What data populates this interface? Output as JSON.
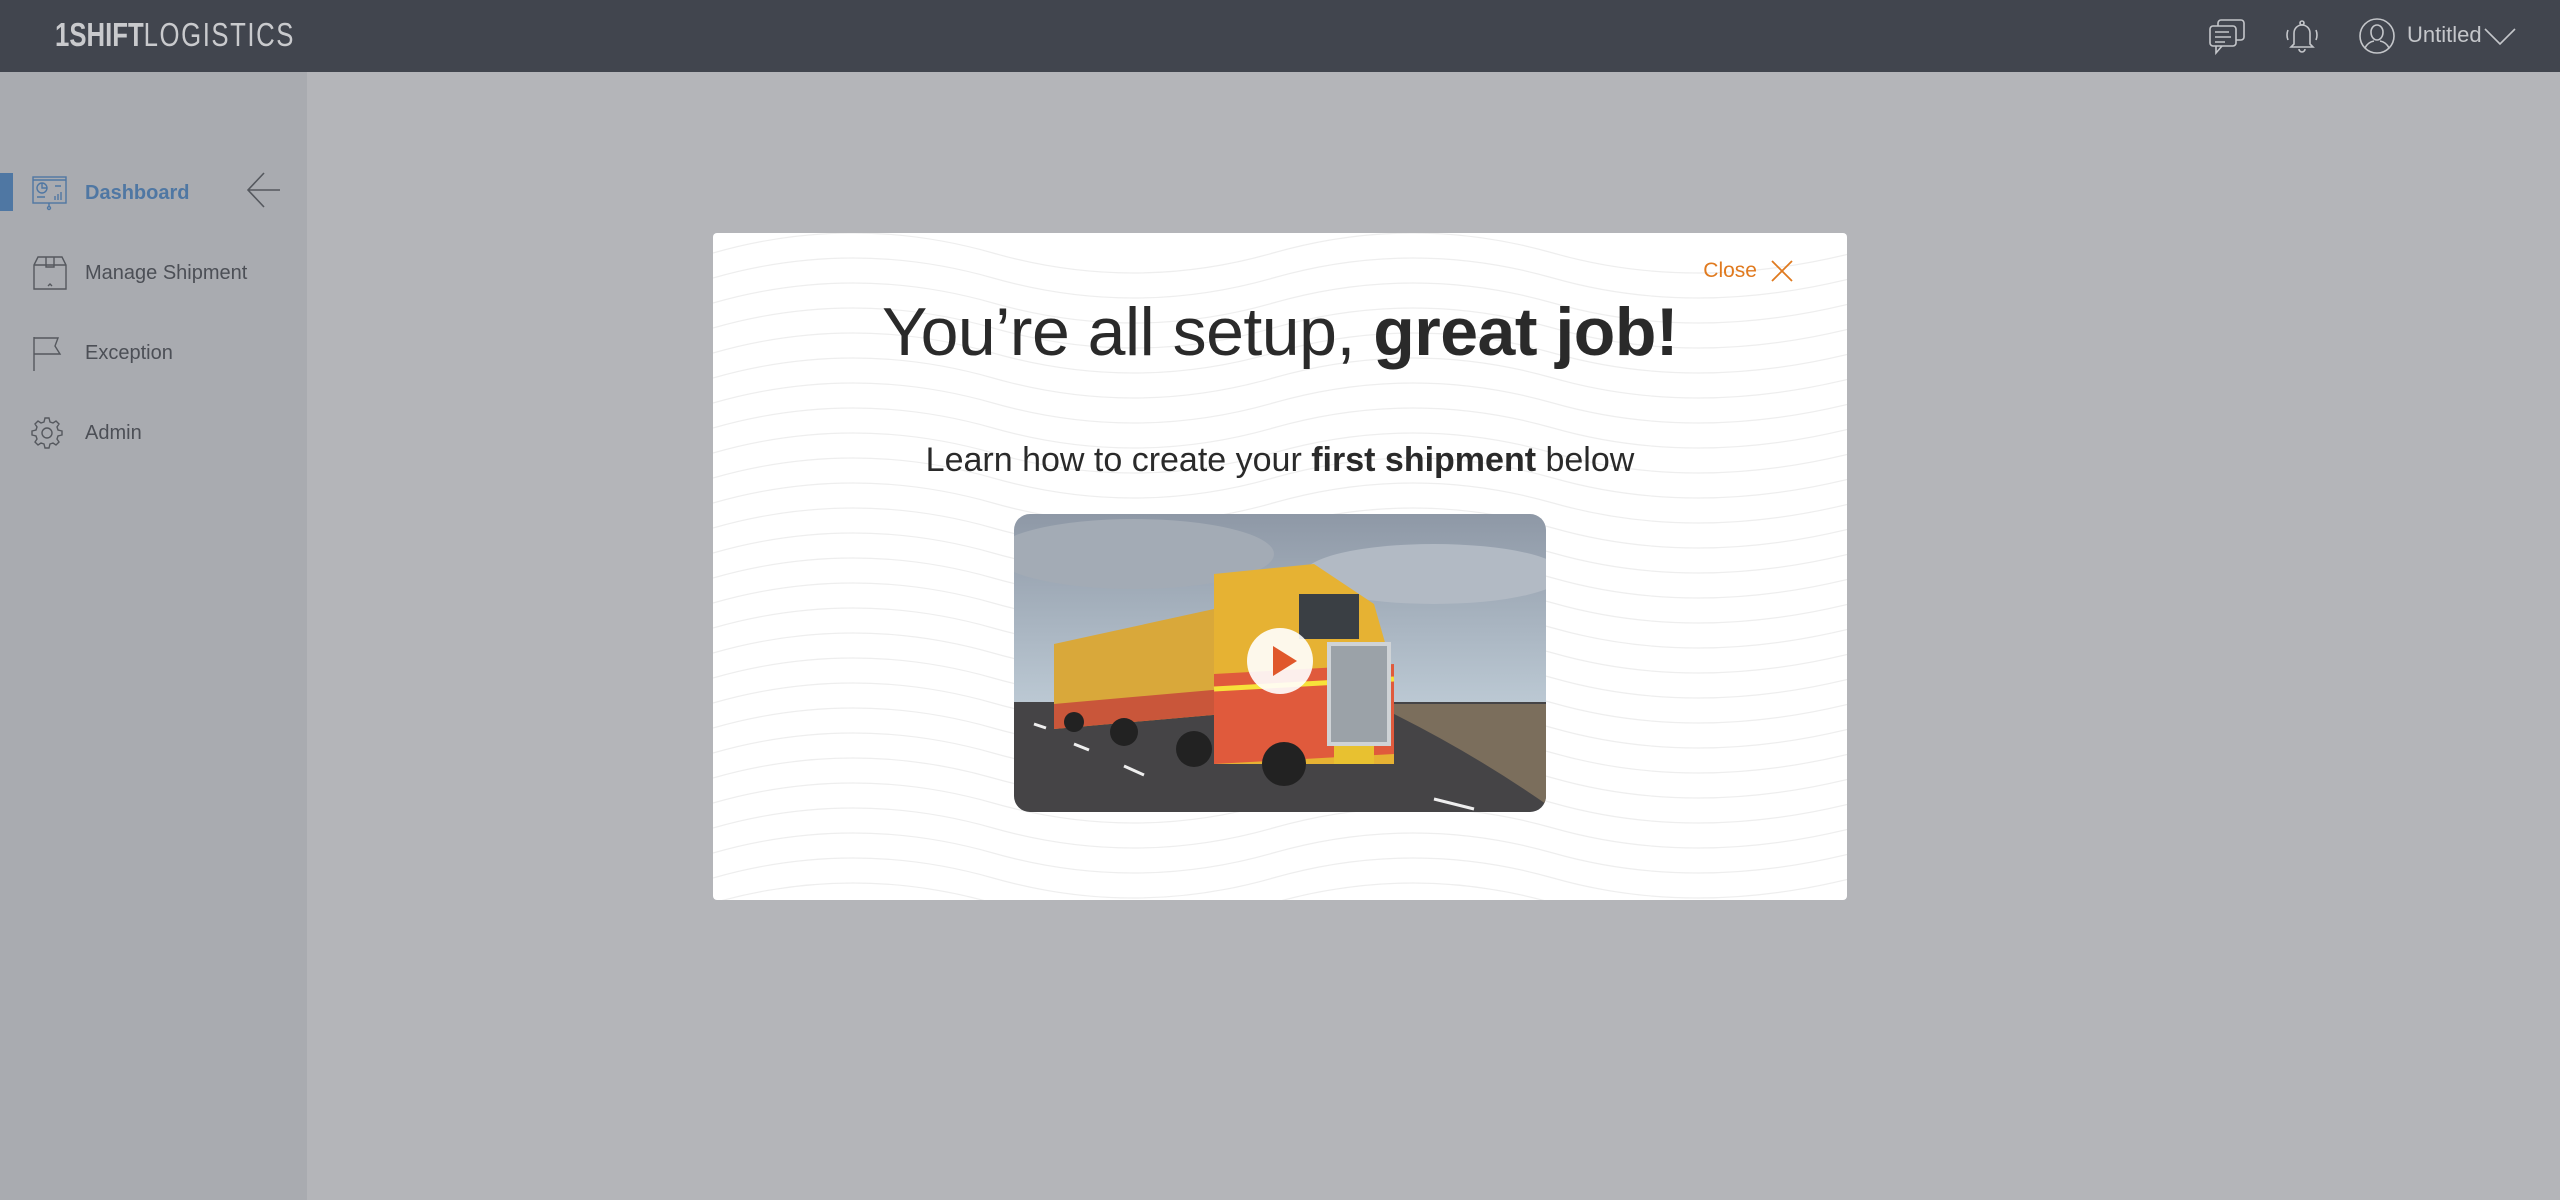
{
  "header": {
    "logo": {
      "bold": "1SHIFT",
      "light": "LOGISTICS"
    },
    "icons": [
      "chat-icon",
      "bell-icon",
      "user-avatar-icon",
      "chevron-down-icon"
    ],
    "user_name": "Untitled"
  },
  "sidebar": {
    "collapse_icon": "arrow-left-icon",
    "items": [
      {
        "label": "Dashboard",
        "icon": "dashboard-presentation-icon",
        "active": true
      },
      {
        "label": "Manage Shipment",
        "icon": "box-icon"
      },
      {
        "label": "Exception",
        "icon": "flag-icon"
      },
      {
        "label": "Admin",
        "icon": "gear-icon"
      }
    ]
  },
  "modal": {
    "close_label": "Close",
    "title_light": "You’re all setup, ",
    "title_bold": "great job!",
    "subtitle_pre": "Learn how to create your ",
    "subtitle_bold": "first shipment",
    "subtitle_post": " below",
    "video_icon": "play-icon"
  },
  "colors": {
    "header": "#41454e",
    "accent": "#4f77a3",
    "close": "#e07a1f"
  }
}
